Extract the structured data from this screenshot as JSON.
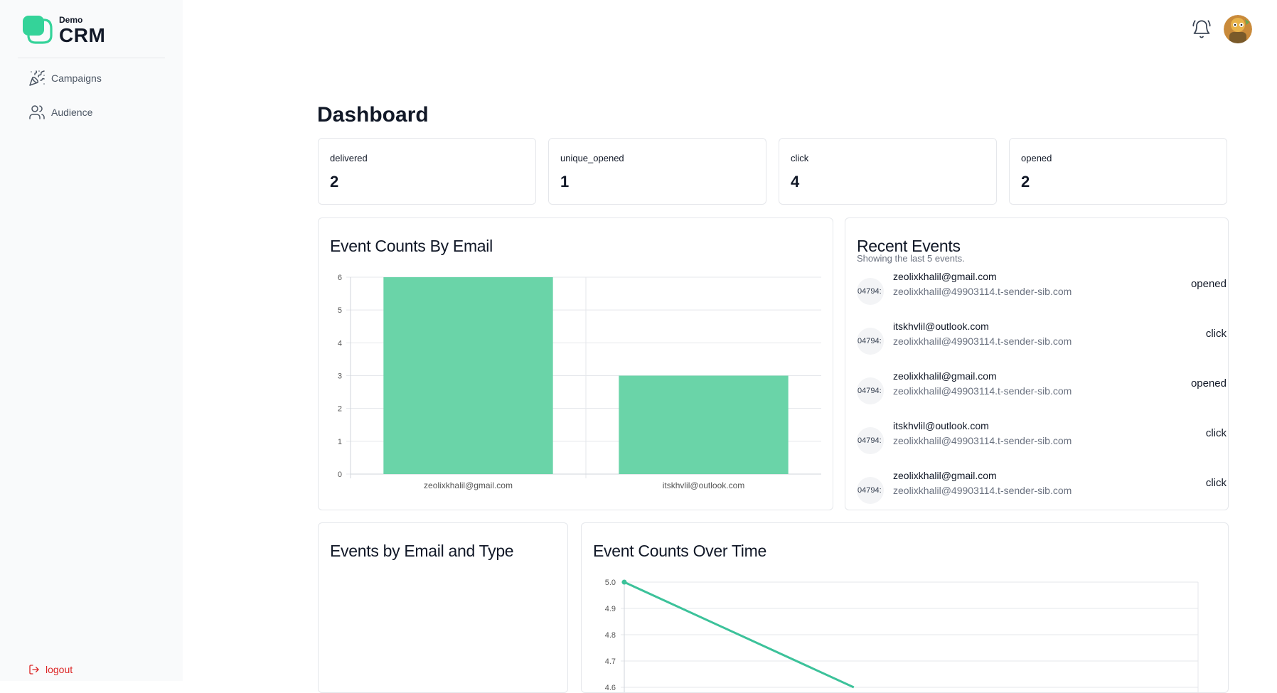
{
  "app": {
    "logo_small": "Demo",
    "logo_big": "CRM",
    "accent": "#34d399",
    "bar_color": "#6ad4a8",
    "line_color": "#3cc29a"
  },
  "sidebar": {
    "items": [
      {
        "label": "Campaigns",
        "icon": "party-popper-icon"
      },
      {
        "label": "Audience",
        "icon": "users-icon"
      }
    ],
    "logout_label": "logout"
  },
  "header": {
    "bell_icon": "bell-icon",
    "avatar_icon": "user-avatar"
  },
  "page": {
    "title": "Dashboard"
  },
  "stats": [
    {
      "label": "delivered",
      "value": "2"
    },
    {
      "label": "unique_opened",
      "value": "1"
    },
    {
      "label": "click",
      "value": "4"
    },
    {
      "label": "opened",
      "value": "2"
    }
  ],
  "event_counts_by_email": {
    "title": "Event Counts By Email",
    "chart_data": {
      "type": "bar",
      "categories": [
        "zeolixkhalil@gmail.com",
        "itskhvlil@outlook.com"
      ],
      "values": [
        6,
        3
      ],
      "ylim": [
        0,
        6
      ],
      "yticks": [
        0,
        1,
        2,
        3,
        4,
        5,
        6
      ],
      "grid": true
    }
  },
  "recent_events": {
    "title": "Recent Events",
    "subtitle": "Showing the last 5 events.",
    "events": [
      {
        "id": "04794:",
        "to": "zeolixkhalil@gmail.com",
        "from": "zeolixkhalil@49903114.t-sender-sib.com",
        "type": "opened"
      },
      {
        "id": "04794:",
        "to": "itskhvlil@outlook.com",
        "from": "zeolixkhalil@49903114.t-sender-sib.com",
        "type": "click"
      },
      {
        "id": "04794:",
        "to": "zeolixkhalil@gmail.com",
        "from": "zeolixkhalil@49903114.t-sender-sib.com",
        "type": "opened"
      },
      {
        "id": "04794:",
        "to": "itskhvlil@outlook.com",
        "from": "zeolixkhalil@49903114.t-sender-sib.com",
        "type": "click"
      },
      {
        "id": "04794:",
        "to": "zeolixkhalil@gmail.com",
        "from": "zeolixkhalil@49903114.t-sender-sib.com",
        "type": "click"
      }
    ]
  },
  "events_by_email_type": {
    "title": "Events by Email and Type"
  },
  "event_counts_over_time": {
    "title": "Event Counts Over Time",
    "chart_data": {
      "type": "line",
      "yticks": [
        "5.0",
        "4.9",
        "4.8",
        "4.7",
        "4.6"
      ],
      "ylim": [
        4.6,
        5.0
      ],
      "points": [
        {
          "x": 0,
          "y": 5.0
        },
        {
          "x": 0.4,
          "y": 4.6
        }
      ],
      "grid": true
    }
  }
}
